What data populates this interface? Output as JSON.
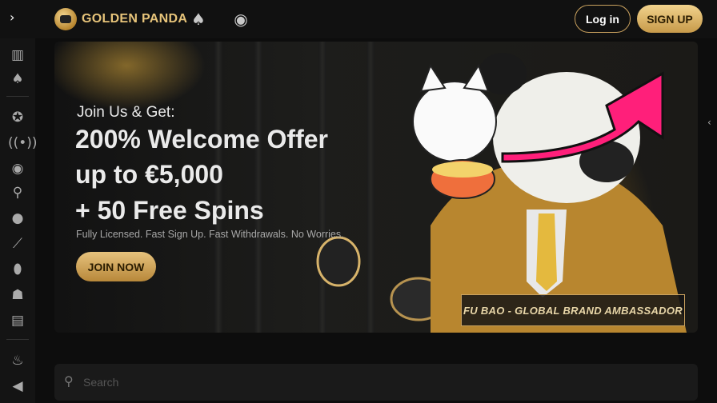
{
  "header": {
    "brand": "GOLDEN PANDA",
    "login_label": "Log in",
    "signup_label": "SIGN UP"
  },
  "hero": {
    "intro": "Join Us & Get:",
    "headline_1": "200% Welcome Offer",
    "headline_2": "up to €5,000",
    "headline_3": "+ 50 Free Spins",
    "note": "Fully Licensed. Fast Sign Up. Fast Withdrawals. No Worries.",
    "cta_label": "JOIN NOW",
    "ambassador_label": "FU BAO - GLOBAL BRAND AMBASSADOR"
  },
  "search": {
    "placeholder": "Search"
  },
  "icons": {
    "expand": "chevron-right-icon",
    "casino": "spade-icon",
    "sports": "soccer-ball-icon"
  },
  "colors": {
    "gold": "#c9a15e",
    "background": "#0d0d0d",
    "arrow": "#ff1f7a"
  }
}
